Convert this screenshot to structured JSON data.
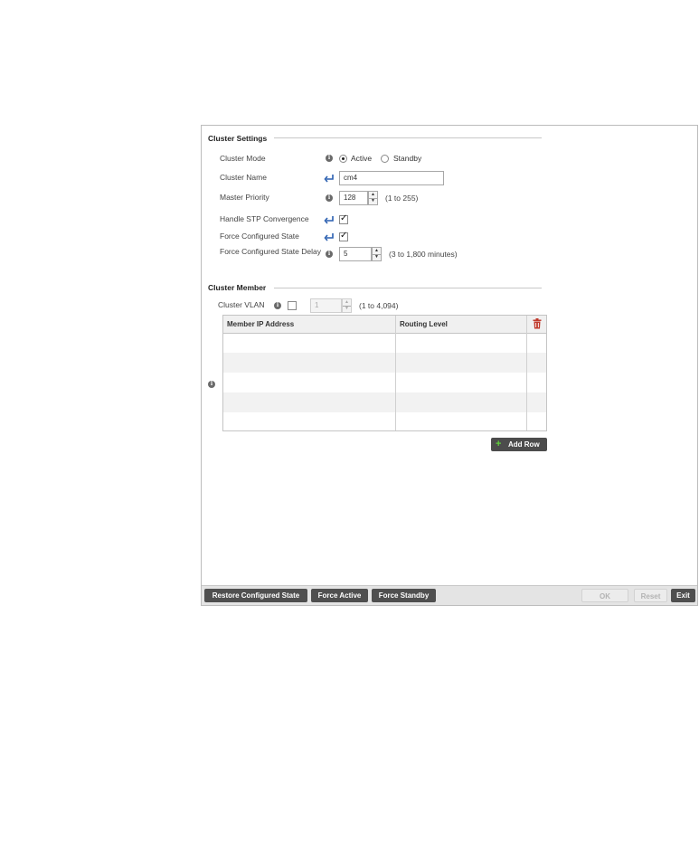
{
  "cluster_settings": {
    "title": "Cluster Settings",
    "mode": {
      "label": "Cluster Mode",
      "options": [
        "Active",
        "Standby"
      ],
      "selected": "Active"
    },
    "name": {
      "label": "Cluster Name",
      "value": "cm4"
    },
    "master_priority": {
      "label": "Master Priority",
      "value": "128",
      "hint": "(1 to 255)"
    },
    "handle_stp": {
      "label": "Handle STP Convergence",
      "checked": true
    },
    "force_configured_state": {
      "label": "Force Configured State",
      "checked": true
    },
    "force_configured_state_delay": {
      "label": "Force Configured State Delay",
      "value": "5",
      "hint": "(3 to 1,800 minutes)"
    }
  },
  "cluster_member": {
    "title": "Cluster Member",
    "vlan": {
      "label": "Cluster VLAN",
      "value": "1",
      "hint": "(1 to 4,094)",
      "checked": false
    },
    "table": {
      "columns": [
        "Member IP Address",
        "Routing Level"
      ],
      "rows": 5
    },
    "add_row_label": "Add Row"
  },
  "footer": {
    "restore": "Restore Configured State",
    "force_active": "Force Active",
    "force_standby": "Force Standby",
    "ok": "OK",
    "reset": "Reset",
    "exit": "Exit"
  },
  "icons": {
    "info": "info-icon",
    "inherit": "inherit-arrow-icon",
    "delete": "trash-icon",
    "add": "plus-icon"
  },
  "colors": {
    "dark_button": "#4f4f4f",
    "trash": "#c0392b",
    "add_plus": "#5fcf3a",
    "inherit_arrow": "#2a5fb0"
  }
}
